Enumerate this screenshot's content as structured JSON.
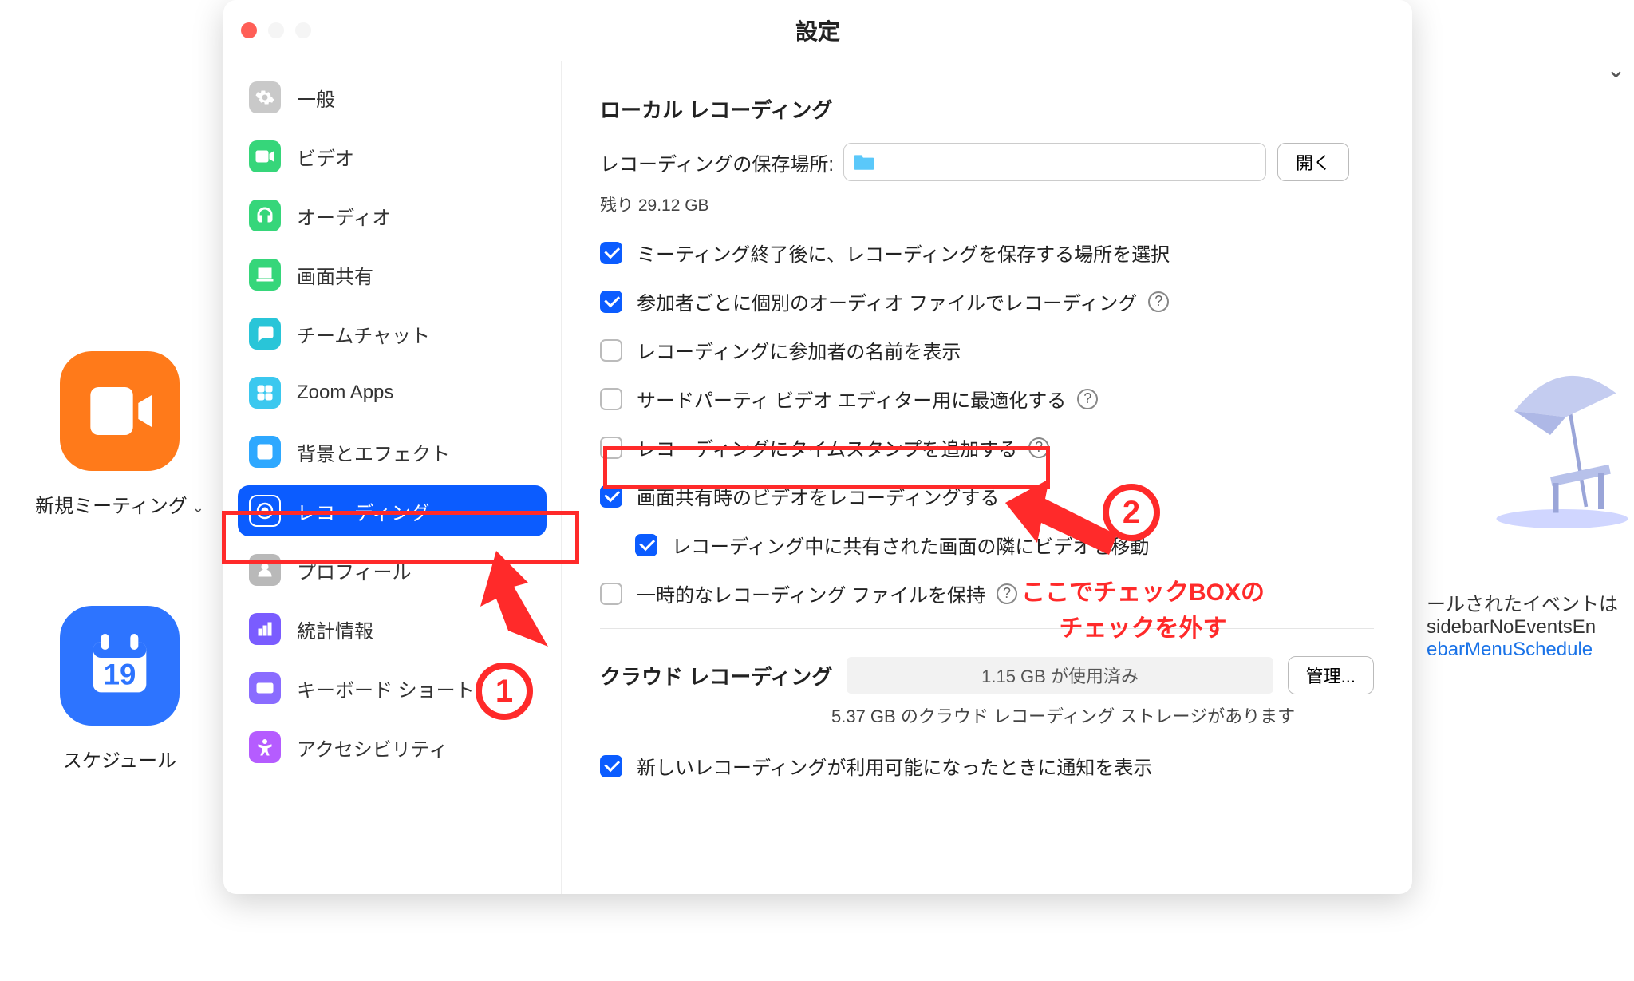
{
  "bg": {
    "new_meeting": "新規ミーティング",
    "schedule": "スケジュール",
    "cal_day": "19",
    "right_line1": "ールされたイベントは",
    "right_line2": "sidebarNoEventsEn",
    "right_line3": "ebarMenuSchedule"
  },
  "window": {
    "title": "設定"
  },
  "sidebar": {
    "items": [
      {
        "label": "一般",
        "color": "#c9c9c9",
        "icon": "gear"
      },
      {
        "label": "ビデオ",
        "color": "#36d67a",
        "icon": "video"
      },
      {
        "label": "オーディオ",
        "color": "#36d67a",
        "icon": "headphones"
      },
      {
        "label": "画面共有",
        "color": "#36d67a",
        "icon": "share"
      },
      {
        "label": "チームチャット",
        "color": "#29c5d8",
        "icon": "chat"
      },
      {
        "label": "Zoom Apps",
        "color": "#3bc8ef",
        "icon": "apps"
      },
      {
        "label": "背景とエフェクト",
        "color": "#2ea8ff",
        "icon": "bg"
      },
      {
        "label": "レコーディング",
        "color": "#0b5cff",
        "icon": "record"
      },
      {
        "label": "プロフィール",
        "color": "#b9b9b9",
        "icon": "profile"
      },
      {
        "label": "統計情報",
        "color": "#7a5cff",
        "icon": "stats"
      },
      {
        "label": "キーボード ショートカット",
        "color": "#8a6cff",
        "icon": "keyboard"
      },
      {
        "label": "アクセシビリティ",
        "color": "#b55cff",
        "icon": "a11y"
      }
    ],
    "active_index": 7
  },
  "panel": {
    "local_title": "ローカル レコーディング",
    "location_label": "レコーディングの保存場所:",
    "open_btn": "開く",
    "remaining": "残り 29.12 GB",
    "checks": [
      {
        "label": "ミーティング終了後に、レコーディングを保存する場所を選択",
        "checked": true,
        "help": false
      },
      {
        "label": "参加者ごとに個別のオーディオ ファイルでレコーディング",
        "checked": true,
        "help": true
      },
      {
        "label": "レコーディングに参加者の名前を表示",
        "checked": false,
        "help": false
      },
      {
        "label": "サードパーティ ビデオ エディター用に最適化する",
        "checked": false,
        "help": true
      },
      {
        "label": "レコーディングにタイムスタンプを追加する",
        "checked": false,
        "help": true
      },
      {
        "label": "画面共有時のビデオをレコーディングする",
        "checked": true,
        "help": false
      },
      {
        "label": "レコーディング中に共有された画面の隣にビデオを移動",
        "checked": true,
        "help": false,
        "indent": true
      },
      {
        "label": "一時的なレコーディング ファイルを保持",
        "checked": false,
        "help": true
      }
    ],
    "cloud_title": "クラウド レコーディング",
    "cloud_used": "1.15 GB が使用済み",
    "manage_btn": "管理...",
    "cloud_remaining": "5.37 GB のクラウド レコーディング ストレージがあります",
    "cloud_check": {
      "label": "新しいレコーディングが利用可能になったときに通知を表示",
      "checked": true
    }
  },
  "annotations": {
    "n1": "1",
    "n2": "2",
    "text1": "ここでチェックBOXの",
    "text2": "チェックを外す"
  }
}
